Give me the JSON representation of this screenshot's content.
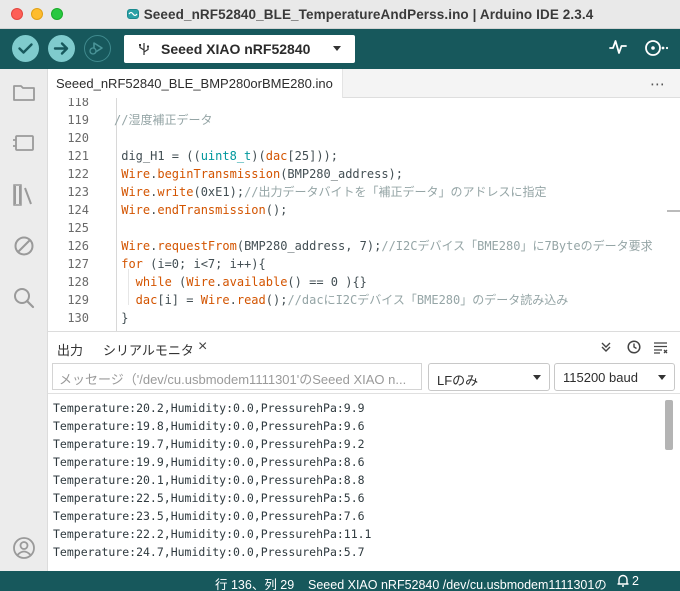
{
  "window": {
    "title": "Seeed_nRF52840_BLE_TemperatureAndPerss.ino | Arduino IDE 2.3.4"
  },
  "toolbar": {
    "board_label": "Seeed XIAO nRF52840",
    "verify_icon": "checkmark-icon",
    "upload_icon": "arrow-right-icon",
    "debug_icon": "debug-icon",
    "plotter_icon": "serial-plotter-icon",
    "monitor_icon": "serial-monitor-icon"
  },
  "editor": {
    "tab_label": "Seeed_nRF52840_BLE_BMP280orBME280.ino",
    "more_label": "⋯",
    "lines": [
      {
        "num": "118",
        "parts": [
          {
            "t": "",
            "c": "c-plain"
          }
        ]
      },
      {
        "num": "119",
        "parts": [
          {
            "t": "//湿度補正データ",
            "c": "c-comment"
          }
        ]
      },
      {
        "num": "120",
        "parts": [
          {
            "t": "",
            "c": "c-plain"
          }
        ]
      },
      {
        "num": "121",
        "parts": [
          {
            "t": " dig_H1 = ((",
            "c": "c-plain"
          },
          {
            "t": "uint8_t",
            "c": "c-type"
          },
          {
            "t": ")(",
            "c": "c-plain"
          },
          {
            "t": "dac",
            "c": "c-kw"
          },
          {
            "t": "[25]));",
            "c": "c-plain"
          }
        ]
      },
      {
        "num": "122",
        "parts": [
          {
            "t": " Wire",
            "c": "c-kw"
          },
          {
            "t": ".",
            "c": "c-plain"
          },
          {
            "t": "beginTransmission",
            "c": "c-kw"
          },
          {
            "t": "(BMP280_address);",
            "c": "c-plain"
          }
        ]
      },
      {
        "num": "123",
        "parts": [
          {
            "t": " Wire",
            "c": "c-kw"
          },
          {
            "t": ".",
            "c": "c-plain"
          },
          {
            "t": "write",
            "c": "c-kw"
          },
          {
            "t": "(0xE1);",
            "c": "c-plain"
          },
          {
            "t": "//出力データバイトを「補正データ」のアドレスに指定",
            "c": "c-comment"
          }
        ]
      },
      {
        "num": "124",
        "parts": [
          {
            "t": " Wire",
            "c": "c-kw"
          },
          {
            "t": ".",
            "c": "c-plain"
          },
          {
            "t": "endTransmission",
            "c": "c-kw"
          },
          {
            "t": "();",
            "c": "c-plain"
          }
        ]
      },
      {
        "num": "125",
        "parts": [
          {
            "t": "",
            "c": "c-plain"
          }
        ]
      },
      {
        "num": "126",
        "parts": [
          {
            "t": " Wire",
            "c": "c-kw"
          },
          {
            "t": ".",
            "c": "c-plain"
          },
          {
            "t": "requestFrom",
            "c": "c-kw"
          },
          {
            "t": "(BMP280_address, 7);",
            "c": "c-plain"
          },
          {
            "t": "//I2Cデバイス「BME280」に7Byteのデータ要求",
            "c": "c-comment"
          }
        ]
      },
      {
        "num": "127",
        "parts": [
          {
            "t": " for",
            "c": "c-kw"
          },
          {
            "t": " (i=0; i<7; i++){",
            "c": "c-plain"
          }
        ]
      },
      {
        "num": "128",
        "parts": [
          {
            "t": "   while",
            "c": "c-kw"
          },
          {
            "t": " (",
            "c": "c-plain"
          },
          {
            "t": "Wire",
            "c": "c-kw"
          },
          {
            "t": ".",
            "c": "c-plain"
          },
          {
            "t": "available",
            "c": "c-kw"
          },
          {
            "t": "() == 0 ){}",
            "c": "c-plain"
          }
        ]
      },
      {
        "num": "129",
        "parts": [
          {
            "t": "   dac",
            "c": "c-kw"
          },
          {
            "t": "[i] = ",
            "c": "c-plain"
          },
          {
            "t": "Wire",
            "c": "c-kw"
          },
          {
            "t": ".",
            "c": "c-plain"
          },
          {
            "t": "read",
            "c": "c-kw"
          },
          {
            "t": "();",
            "c": "c-plain"
          },
          {
            "t": "//dacにI2Cデバイス「BME280」のデータ読み込み",
            "c": "c-comment"
          }
        ]
      },
      {
        "num": "130",
        "parts": [
          {
            "t": " }",
            "c": "c-plain"
          }
        ]
      }
    ]
  },
  "panel": {
    "output_tab": "出力",
    "serial_tab": "シリアルモニタ",
    "close_glyph": "×",
    "message_placeholder": "メッセージ（'/dev/cu.usbmodem1111301'のSeeed XIAO n...",
    "line_ending": "LFのみ",
    "baud_rate": "115200 baud",
    "serial_lines": [
      "Temperature:20.2,Humidity:0.0,PressurehPa:9.9",
      "Temperature:19.8,Humidity:0.0,PressurehPa:9.6",
      "Temperature:19.7,Humidity:0.0,PressurehPa:9.2",
      "Temperature:19.9,Humidity:0.0,PressurehPa:8.6",
      "Temperature:20.1,Humidity:0.0,PressurehPa:8.8",
      "Temperature:22.5,Humidity:0.0,PressurehPa:5.6",
      "Temperature:23.5,Humidity:0.0,PressurehPa:7.6",
      "Temperature:22.2,Humidity:0.0,PressurehPa:11.1",
      "Temperature:24.7,Humidity:0.0,PressurehPa:5.7"
    ]
  },
  "status": {
    "position": "行 136、列 29",
    "board_port": "Seeed XIAO nRF52840 /dev/cu.usbmodem1111301の",
    "notification_count": "2"
  },
  "colors": {
    "toolbar_teal": "#17585c",
    "button_light_teal": "#7fcbcd",
    "keyword_orange": "#d35400",
    "type_teal": "#00979c",
    "comment_gray": "#95a5a6"
  }
}
